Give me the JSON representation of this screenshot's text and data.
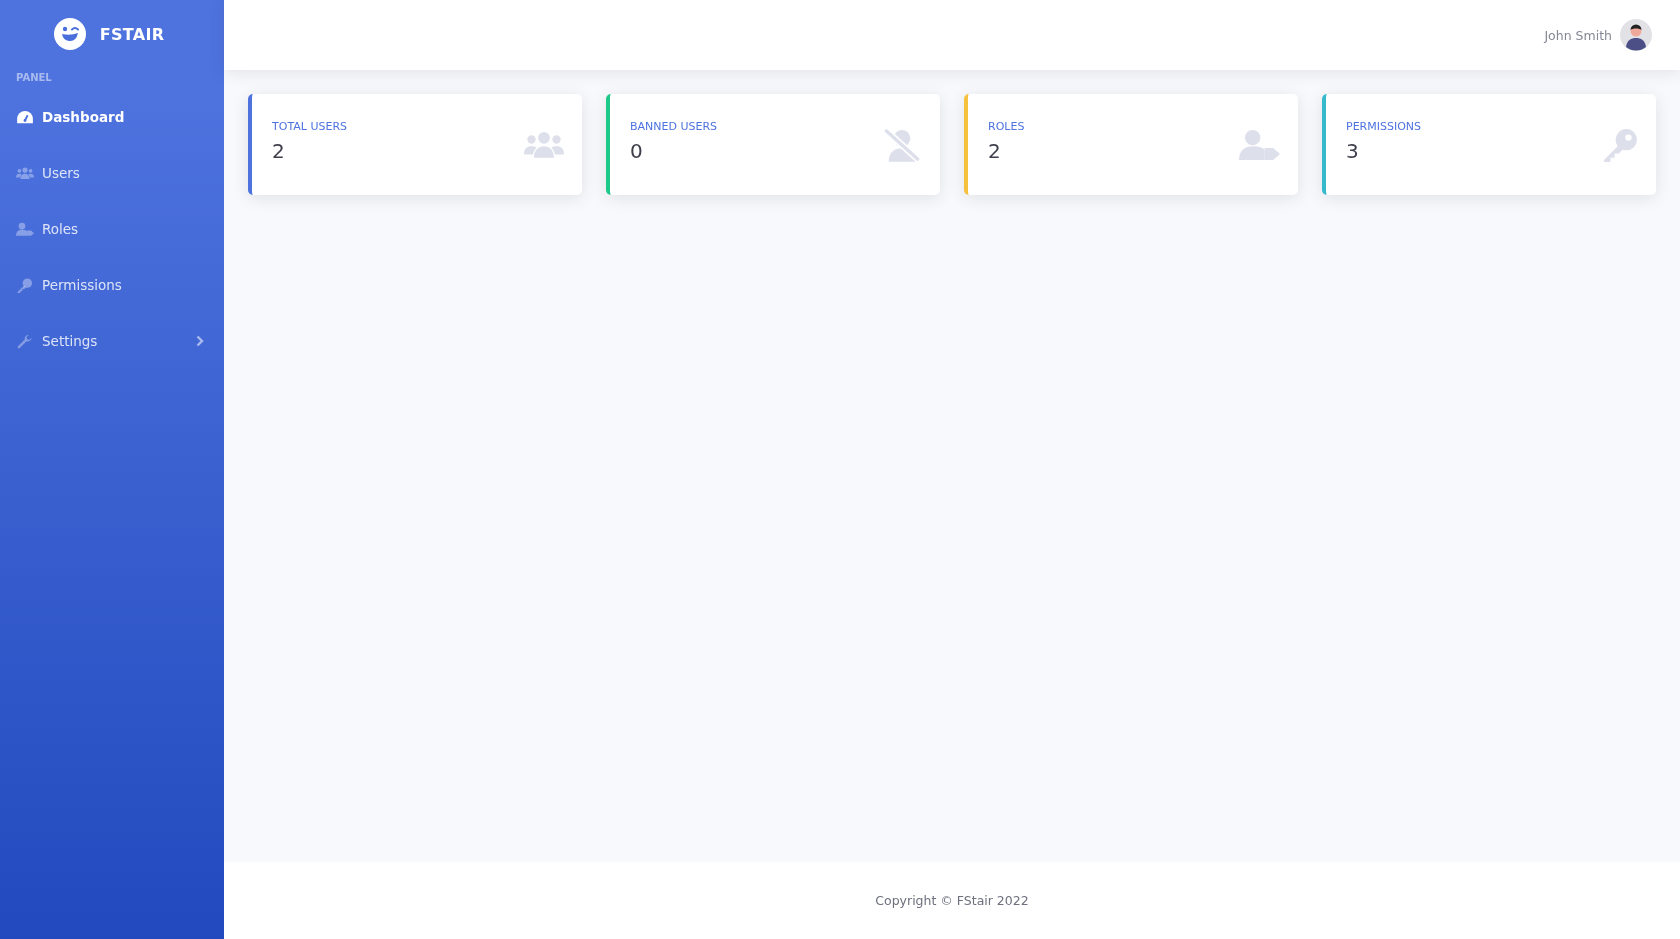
{
  "brand": {
    "name": "FSTAIR"
  },
  "sidebar": {
    "heading": "PANEL",
    "items": [
      {
        "label": "Dashboard",
        "kind": "gauge",
        "selected": true,
        "expandable": false
      },
      {
        "label": "Users",
        "kind": "users",
        "selected": false,
        "expandable": false
      },
      {
        "label": "Roles",
        "kind": "roles",
        "selected": false,
        "expandable": false
      },
      {
        "label": "Permissions",
        "kind": "key",
        "selected": false,
        "expandable": false
      },
      {
        "label": "Settings",
        "kind": "wrench",
        "selected": false,
        "expandable": true
      }
    ]
  },
  "topbar": {
    "user_name": "John Smith"
  },
  "cards": [
    {
      "label": "TOTAL USERS",
      "value": "2",
      "kind": "users",
      "color": "#4e73df"
    },
    {
      "label": "BANNED USERS",
      "value": "0",
      "kind": "banned",
      "color": "#1cc88a"
    },
    {
      "label": "ROLES",
      "value": "2",
      "kind": "roles",
      "color": "#f6c23e"
    },
    {
      "label": "PERMISSIONS",
      "value": "3",
      "kind": "key",
      "color": "#36b9cc"
    }
  ],
  "footer": {
    "text": "Copyright © FStair 2022"
  }
}
